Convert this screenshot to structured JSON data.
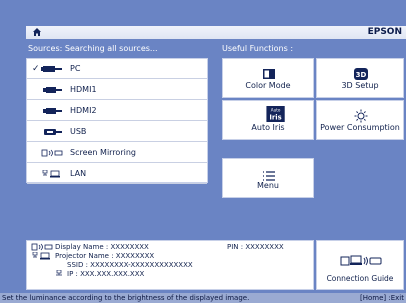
{
  "header": {
    "brand": "EPSON",
    "home_icon": "home-icon"
  },
  "sources": {
    "heading": "Sources: Searching all sources...",
    "items": [
      {
        "label": "PC",
        "selected": true,
        "icon": "pc-input-icon"
      },
      {
        "label": "HDMI1",
        "selected": false,
        "icon": "hdmi-icon"
      },
      {
        "label": "HDMI2",
        "selected": false,
        "icon": "hdmi-icon"
      },
      {
        "label": "USB",
        "selected": false,
        "icon": "usb-icon"
      },
      {
        "label": "Screen Mirroring",
        "selected": false,
        "icon": "screen-mirroring-icon"
      },
      {
        "label": "LAN",
        "selected": false,
        "icon": "lan-icon"
      }
    ],
    "check_mark": "✓"
  },
  "functions": {
    "heading": "Useful Functions :",
    "items": [
      {
        "label": "Color Mode",
        "icon": "color-mode-icon"
      },
      {
        "label": "3D Setup",
        "icon": "3d-setup-icon"
      },
      {
        "label": "Auto Iris",
        "icon": "auto-iris-icon"
      },
      {
        "label": "Power Consumption",
        "icon": "power-consumption-icon"
      },
      {
        "label": "Menu",
        "icon": "menu-icon"
      }
    ],
    "icon_text": {
      "three_d": "3D",
      "iris_top": "Auto",
      "iris_bottom": "Iris"
    }
  },
  "info": {
    "display_name": "Display Name : XXXXXXXX",
    "projector_name": "Projector Name : XXXXXXXX",
    "ssid": "SSID : XXXXXXXX-XXXXXXXXXXXXX",
    "ip": "IP : XXX.XXX.XXX.XXX",
    "pin": "PIN : XXXXXXXX"
  },
  "guide": {
    "label": "Connection Guide"
  },
  "status": {
    "message": "Set the luminance according to the brightness of the displayed image.",
    "exit_hint": "[Home] :Exit"
  },
  "colors": {
    "background": "#6a84c4",
    "panel": "#ffffff",
    "text": "#10204c"
  }
}
